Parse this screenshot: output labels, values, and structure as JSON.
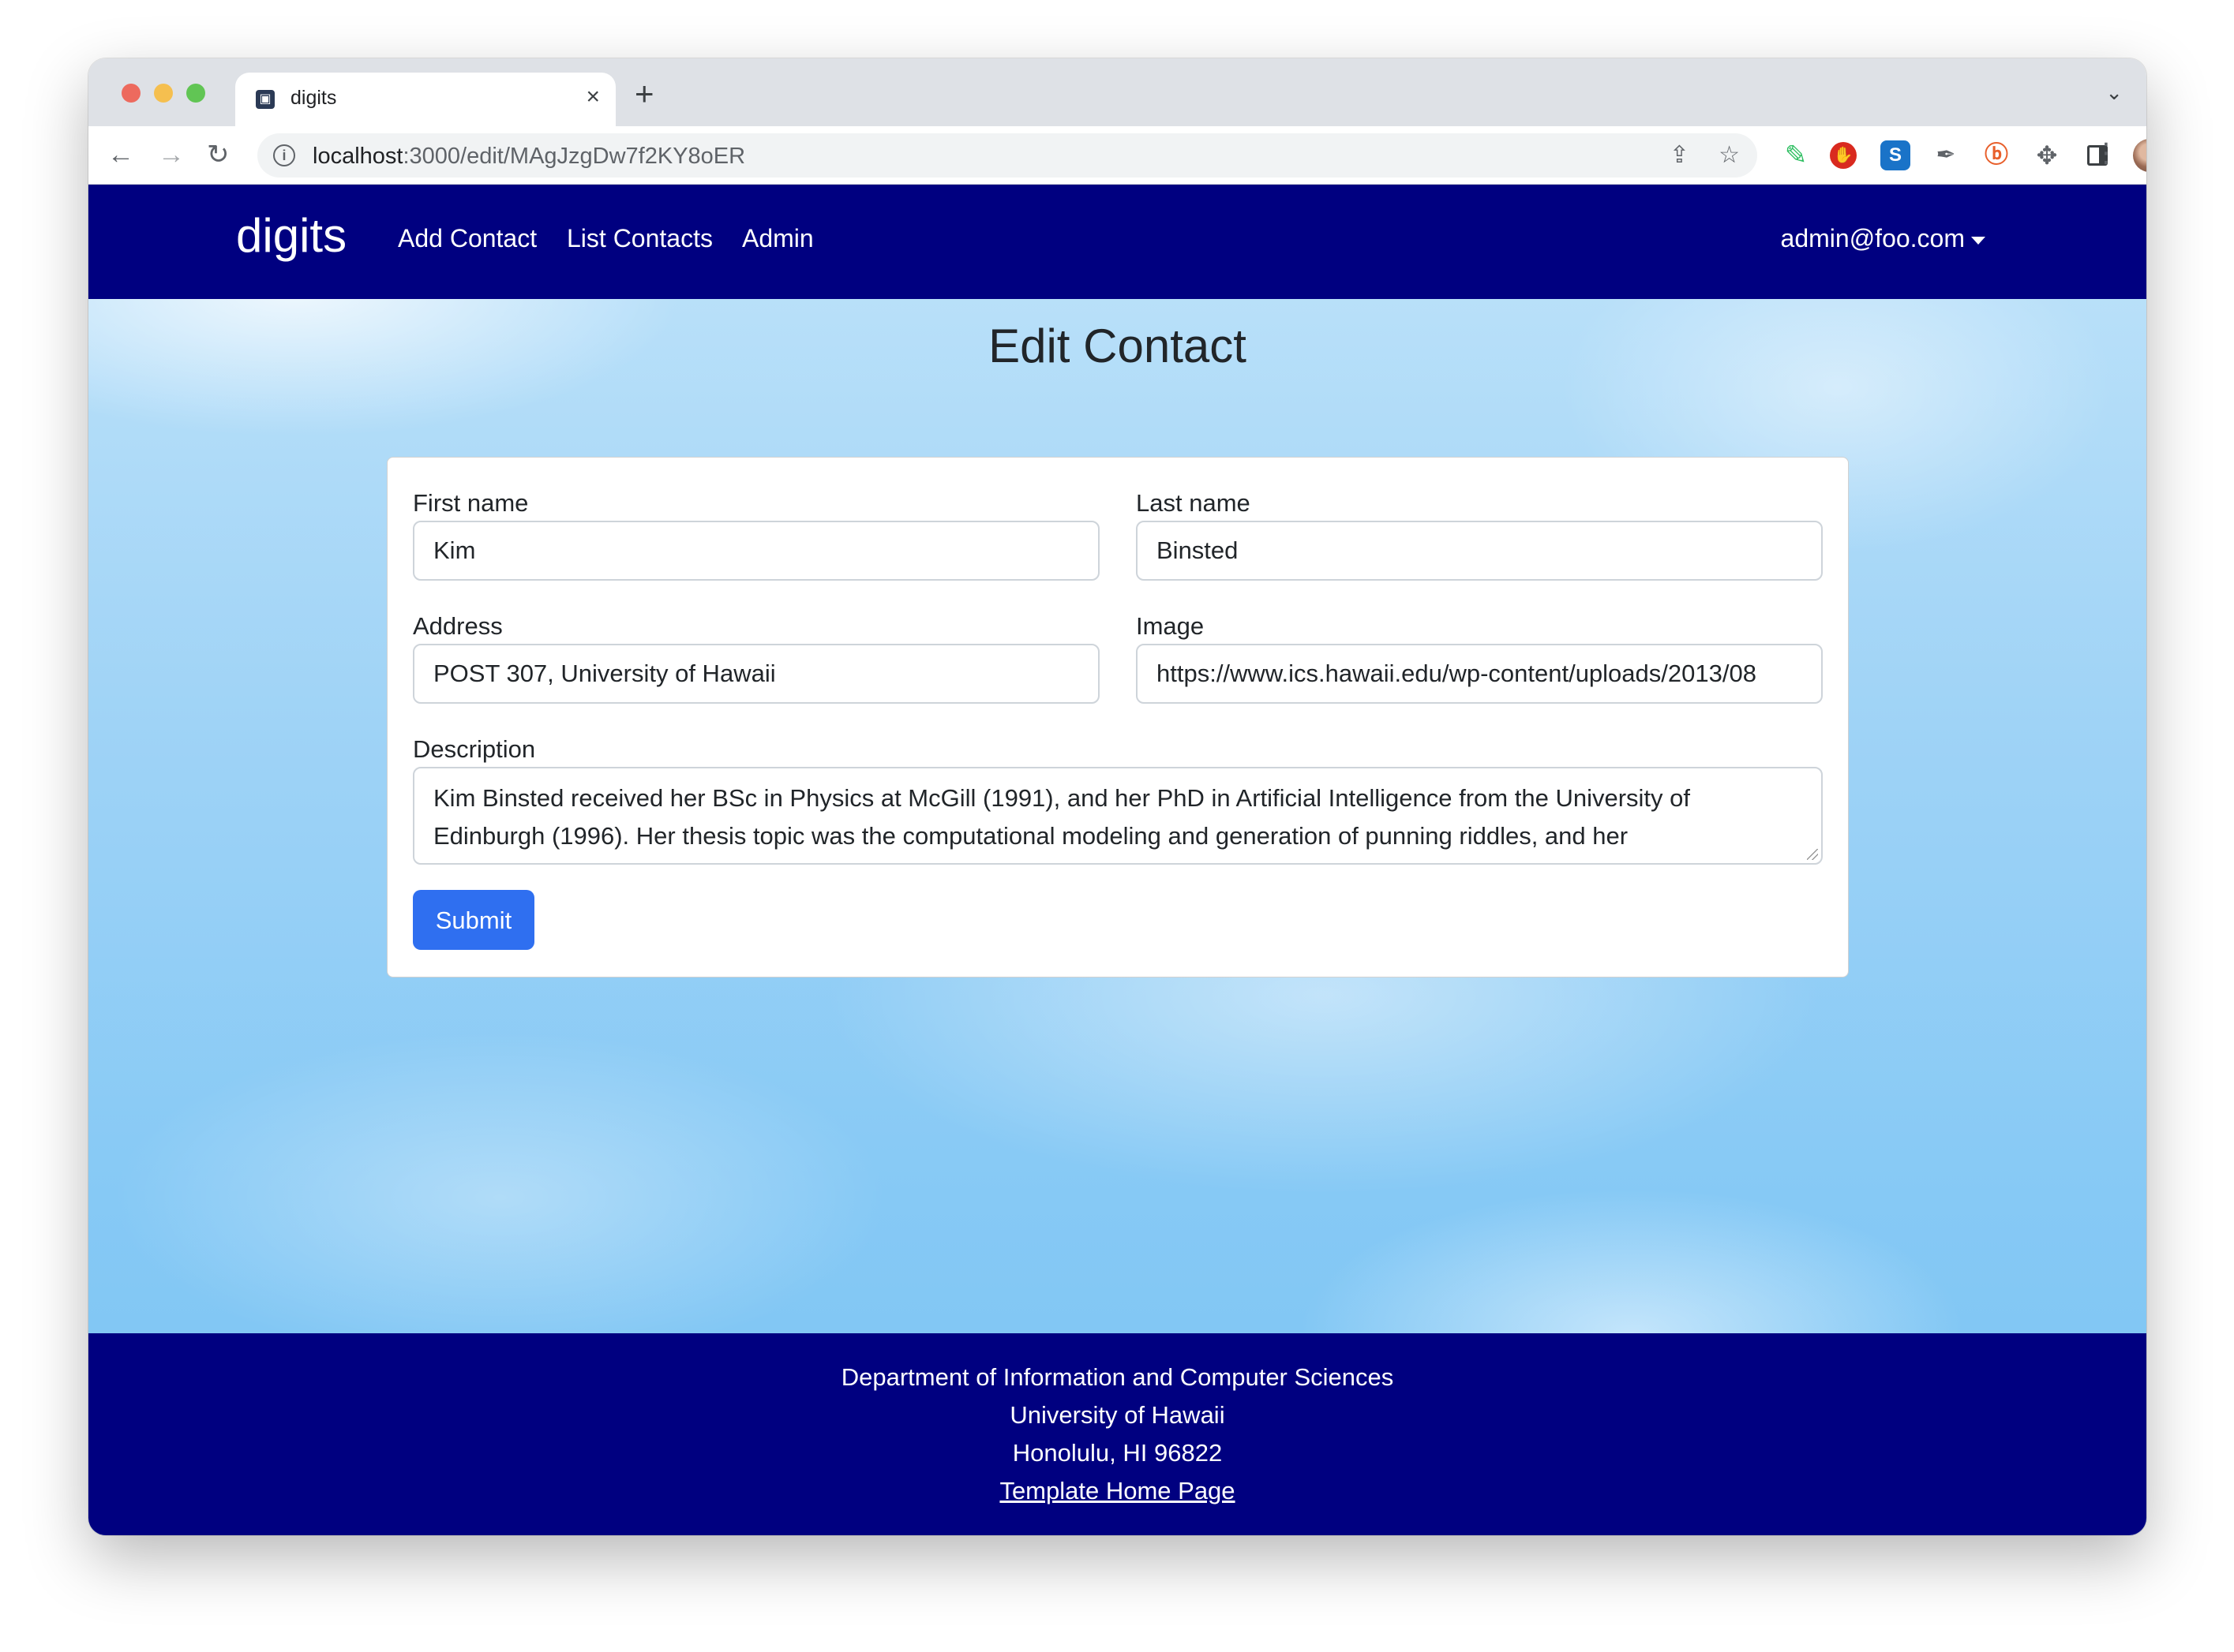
{
  "browser": {
    "tab": {
      "title": "digits",
      "close_glyph": "×"
    },
    "new_tab_glyph": "+",
    "tab_list_glyph": "⌄",
    "nav": {
      "back_glyph": "←",
      "forward_glyph": "→",
      "reload_glyph": "↻"
    },
    "address_bar": {
      "info_glyph": "i",
      "host": "localhost",
      "path": ":3000/edit/MAgJzgDw7f2KY8oER"
    },
    "share_glyph": "⇪",
    "bookmark_glyph": "☆",
    "extensions": [
      {
        "name": "evernote-icon",
        "glyph": "✎"
      },
      {
        "name": "ublock-icon",
        "glyph": "✋"
      },
      {
        "name": "s-extension-icon",
        "glyph": "S"
      },
      {
        "name": "eyedropper-icon",
        "glyph": "✒"
      },
      {
        "name": "honey-icon",
        "glyph": "ⓑ"
      },
      {
        "name": "extensions-puzzle-icon",
        "glyph": "✥"
      }
    ],
    "kebab_glyph": "⋮",
    "colors": {
      "tab_strip": "#dee1e6",
      "omnibox": "#f1f3f4"
    }
  },
  "navbar": {
    "brand": "digits",
    "links": [
      "Add Contact",
      "List Contacts",
      "Admin"
    ],
    "user": "admin@foo.com",
    "background": "#000080"
  },
  "page": {
    "title": "Edit Contact"
  },
  "form": {
    "first_name": {
      "label": "First name",
      "value": "Kim"
    },
    "last_name": {
      "label": "Last name",
      "value": "Binsted"
    },
    "address": {
      "label": "Address",
      "value": "POST 307, University of Hawaii"
    },
    "image": {
      "label": "Image",
      "value": "https://www.ics.hawaii.edu/wp-content/uploads/2013/08"
    },
    "description": {
      "label": "Description",
      "value": "Kim Binsted received her BSc in Physics at McGill (1991), and her PhD in Artificial Intelligence from the University of Edinburgh (1996). Her thesis topic was the computational modeling and generation of punning riddles, and her"
    },
    "submit_label": "Submit",
    "submit_color": "#2f6ff0"
  },
  "footer": {
    "lines": [
      "Department of Information and Computer Sciences",
      "University of Hawaii",
      "Honolulu, HI 96822"
    ],
    "link_text": "Template Home Page",
    "background": "#000080"
  }
}
